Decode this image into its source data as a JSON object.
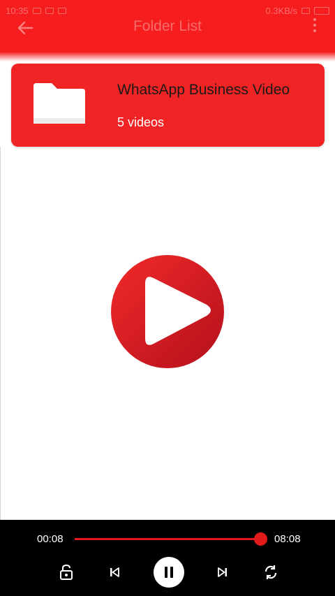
{
  "status_bar": {
    "time": "10:35",
    "network_speed": "0.3KB/s"
  },
  "app_bar": {
    "title": "Folder List"
  },
  "folder": {
    "name": "WhatsApp Business Video",
    "count_label": "5 videos"
  },
  "player": {
    "current_time": "00:08",
    "total_time": "08:08",
    "progress": 1.0
  },
  "colors": {
    "accent": "#f51d1d",
    "card": "#f02424",
    "player_bg": "#000000"
  },
  "icons": {
    "back": "arrow-left-icon",
    "menu": "more-vert-icon",
    "folder": "folder-icon",
    "logo": "play-logo-icon",
    "lock": "lock-open-icon",
    "prev": "skip-previous-icon",
    "pause": "pause-icon",
    "next": "skip-next-icon",
    "repeat": "repeat-icon"
  }
}
